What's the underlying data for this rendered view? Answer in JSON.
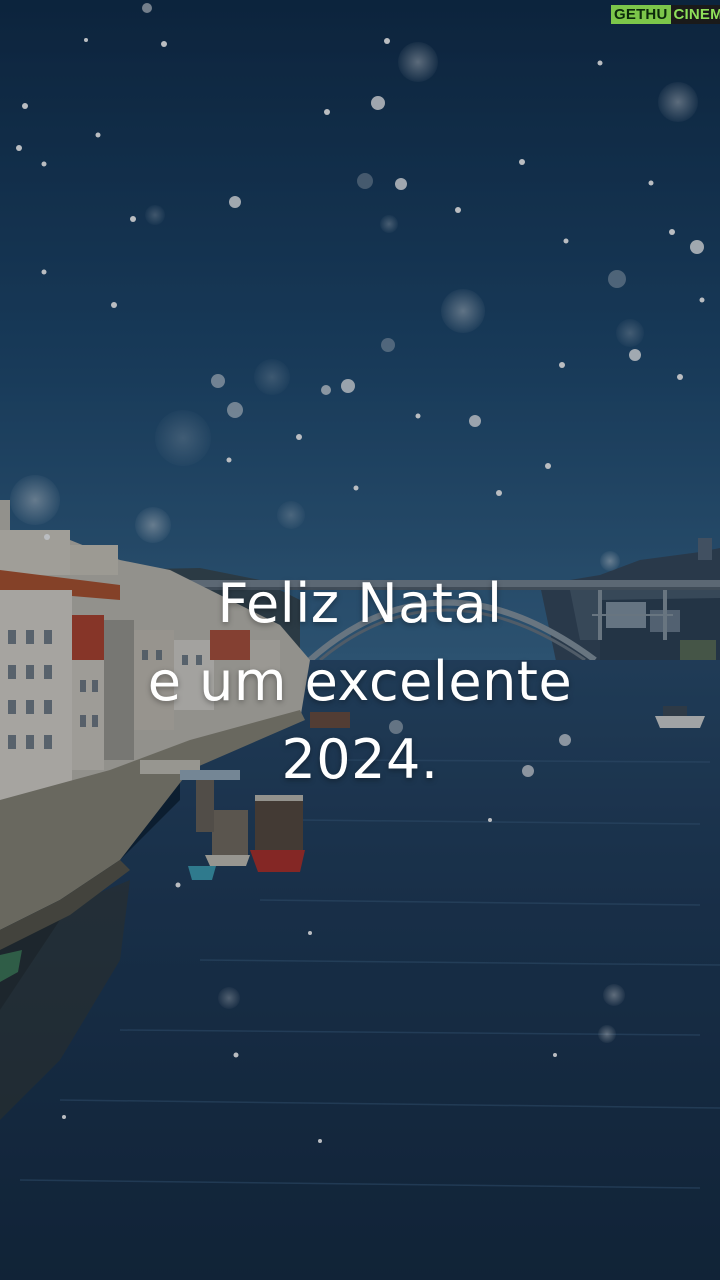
{
  "greeting": {
    "line1": "Feliz Natal",
    "line2": "e um excelente",
    "line3": "2024."
  },
  "watermark": {
    "part1": "GETHU",
    "part2": "CINEMA"
  },
  "colors": {
    "sky_top": "#123252",
    "sky_bottom": "#2e5a7f",
    "river": "#1c3550",
    "text": "#ffffff",
    "watermark_green": "#7cc64a"
  }
}
